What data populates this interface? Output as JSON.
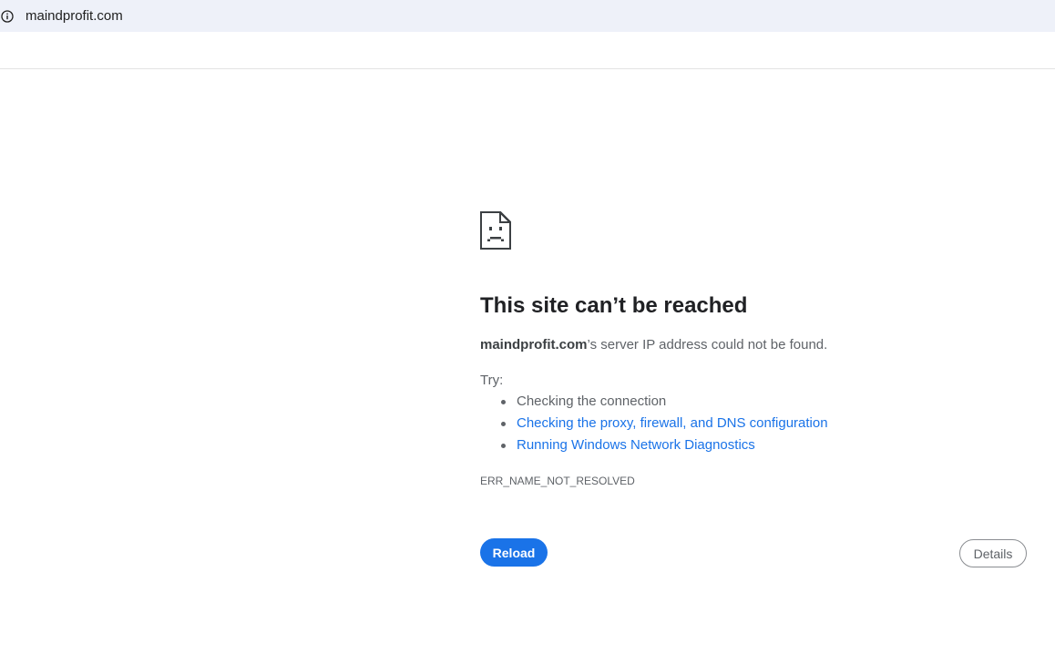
{
  "address_bar": {
    "url": "maindprofit.com",
    "info_icon": "info-circle-icon"
  },
  "error_page": {
    "icon": "sad-page-icon",
    "title": "This site can’t be reached",
    "message_host": "maindprofit.com",
    "message_rest": "’s server IP address could not be found.",
    "try_label": "Try:",
    "suggestions": [
      {
        "label": "Checking the connection",
        "is_link": false
      },
      {
        "label": "Checking the proxy, firewall, and DNS configuration",
        "is_link": true
      },
      {
        "label": "Running Windows Network Diagnostics",
        "is_link": true
      }
    ],
    "error_code": "ERR_NAME_NOT_RESOLVED",
    "reload_label": "Reload",
    "details_label": "Details"
  },
  "colors": {
    "accent": "#1a73e8",
    "address_bar_bg": "#eef1f9",
    "body_text": "#5f6368",
    "title_text": "#202124"
  }
}
